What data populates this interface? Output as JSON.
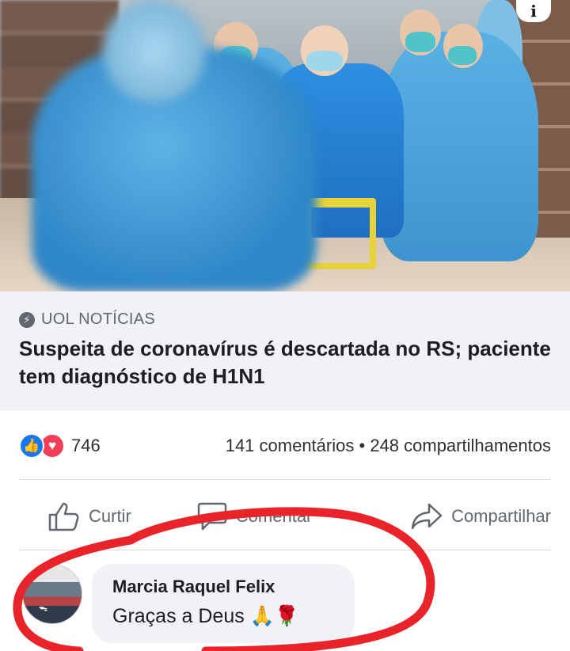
{
  "post": {
    "image_alt": "",
    "info_icon": "info-icon",
    "info_glyph": "i"
  },
  "link_preview": {
    "source": "UOL NOTÍCIAS",
    "source_icon": "bolt-icon",
    "headline": "Suspeita de coronavírus é descartada no RS; paciente tem diagnóstico de H1N1"
  },
  "stats": {
    "reaction_icons": [
      "like-icon",
      "love-icon"
    ],
    "reaction_count": "746",
    "comments": "141 comentários",
    "separator": "•",
    "shares": "248 compartilhamentos"
  },
  "actions": {
    "like": "Curtir",
    "comment": "Comentar",
    "share": "Compartilhar"
  },
  "comment": {
    "author": "Marcia Raquel Felix",
    "text": "Graças a Deus 🙏🌹"
  },
  "colors": {
    "annotation": "#e8232a",
    "facebook_blue": "#1877f2",
    "love_red": "#f33e58",
    "caption_bg": "#f0f2f5"
  }
}
